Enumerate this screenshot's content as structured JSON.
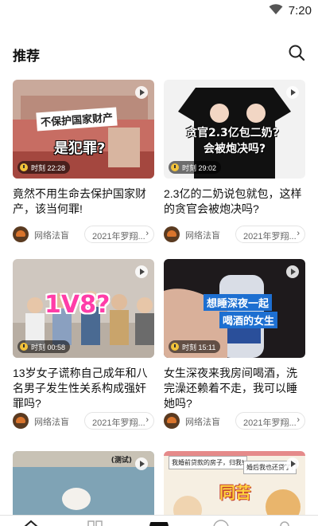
{
  "status_bar": {
    "time": "7:20",
    "icons": [
      "wifi-icon"
    ]
  },
  "header": {
    "title": "推荐",
    "icons": [
      "search-icon"
    ]
  },
  "cards": [
    {
      "title": "竟然不用生命去保护国家财产，该当何罪!",
      "author": "网络法盲",
      "tag": "2021年罗翔...",
      "duration": "时刻 22:28",
      "overlay": [
        "不保护国家财产",
        "是犯罪?"
      ]
    },
    {
      "title": "2.3亿的二奶说包就包，这样的贪官会被炮决吗?",
      "author": "网络法盲",
      "tag": "2021年罗翔...",
      "duration": "时刻 29:02",
      "overlay": [
        "贪官2.3亿包二奶?",
        "会被炮决吗?"
      ]
    },
    {
      "title": "13岁女子谎称自己成年和八名男子发生性关系构成强奸罪吗?",
      "author": "网络法盲",
      "tag": "2021年罗翔...",
      "duration": "时刻 00:58",
      "overlay": [
        "1V8?"
      ]
    },
    {
      "title": "女生深夜来我房间喝酒，洗完澡还赖着不走，我可以睡她吗?",
      "author": "网络法盲",
      "tag": "2021年罗翔...",
      "duration": "时刻 15:11",
      "overlay": [
        "想睡深夜一起",
        "喝酒的女生"
      ]
    },
    {
      "title": "",
      "author": "",
      "tag": "",
      "duration": "",
      "overlay": [
        "(测试)"
      ]
    },
    {
      "title": "",
      "author": "",
      "tag": "",
      "duration": "",
      "overlay": [
        "我婚前贷款的房子，归我!",
        "婚后我也还贷了!",
        "同苦"
      ]
    }
  ],
  "bottom_nav": {
    "icons": [
      "home-icon",
      "category-icon",
      "center-icon",
      "message-icon",
      "profile-icon"
    ]
  }
}
